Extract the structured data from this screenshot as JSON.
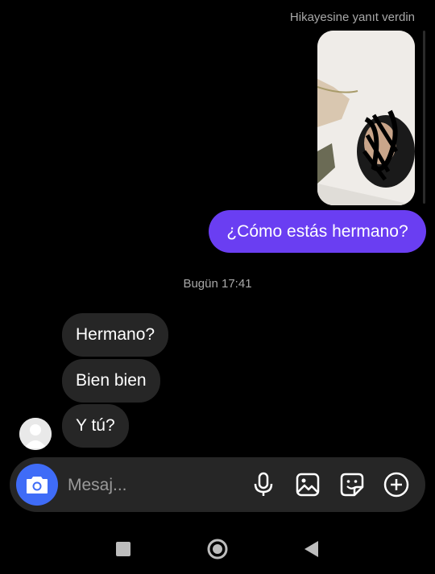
{
  "thread": {
    "story_reply_caption": "Hikayesine yanıt verdin",
    "sent_message": "¿Cómo estás hermano?",
    "timestamp": "Bugün 17:41",
    "received_messages": [
      "Hermano?",
      "Bien bien",
      "Y tú?"
    ]
  },
  "composer": {
    "placeholder": "Mesaj...",
    "icons": [
      "camera-icon",
      "microphone-icon",
      "gallery-icon",
      "sticker-icon",
      "plus-icon"
    ]
  },
  "system_nav": {
    "icons": [
      "recents-square-icon",
      "home-circle-icon",
      "back-triangle-icon"
    ]
  },
  "colors": {
    "background": "#000000",
    "sent_bubble": "#6a3ef2",
    "received_bubble": "#262626",
    "camera_button": "#3f6cf7",
    "secondary_text": "#a8a8a8"
  }
}
